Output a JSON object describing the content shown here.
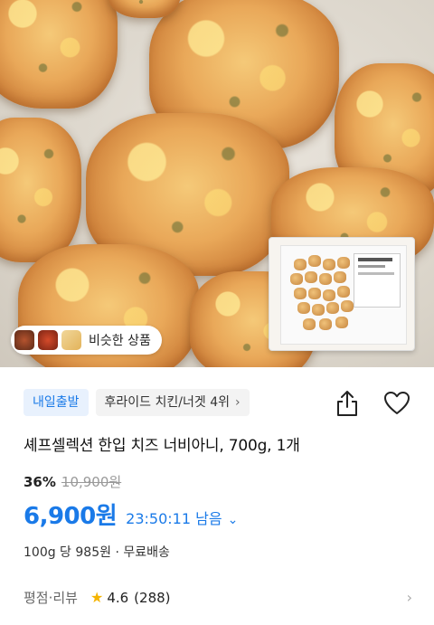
{
  "similar": {
    "label": "비슷한 상품"
  },
  "tags": {
    "delivery": "내일출발",
    "ranking": "후라이드 치킨/너겟 4위"
  },
  "product": {
    "title": "셰프셀렉션 한입 치즈 너비아니, 700g, 1개"
  },
  "price": {
    "discount": "36%",
    "original": "10,900원",
    "sale": "6,900원",
    "countdown": "23:50:11 남음",
    "unit_info": "100g 당 985원 · 무료배송"
  },
  "rating": {
    "label": "평점·리뷰",
    "score": "4.6",
    "count": "(288)"
  },
  "colors": {
    "accent": "#1a7ae8",
    "star": "#f5b400"
  },
  "icons": [
    "share-icon",
    "heart-icon",
    "chevron-right-icon",
    "chevron-down-icon",
    "star-icon"
  ]
}
